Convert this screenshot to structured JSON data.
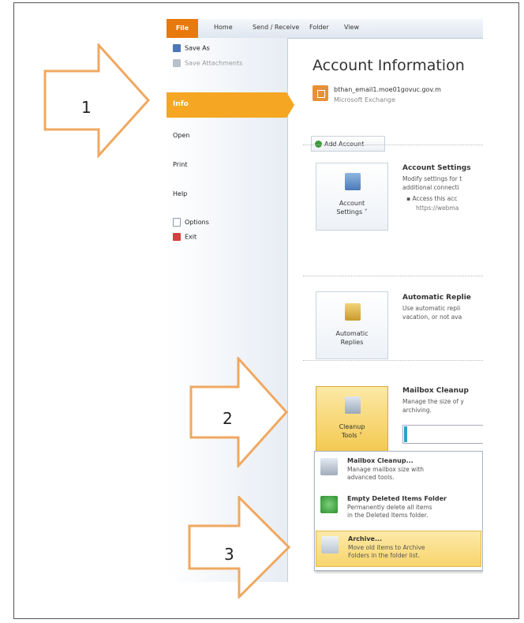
{
  "ribbon": {
    "file_tab": "File",
    "tabs": [
      "Home",
      "Send / Receive",
      "Folder",
      "View"
    ]
  },
  "backstage": {
    "save_as": "Save As",
    "save_attachments": "Save Attachments",
    "info": "Info",
    "open": "Open",
    "print": "Print",
    "help": "Help",
    "options": "Options",
    "exit": "Exit"
  },
  "account": {
    "title": "Account Information",
    "email": "bthan_email1.moe01govuc.gov.m",
    "type": "Microsoft Exchange",
    "add_account": "Add Account"
  },
  "account_settings": {
    "button_line1": "Account",
    "button_line2": "Settings ˅",
    "heading": "Account Settings",
    "line1": "Modify settings for t",
    "line2": "additional connecti",
    "bullet": "Access this acc",
    "url": "https://webma"
  },
  "auto_replies": {
    "button_line1": "Automatic",
    "button_line2": "Replies",
    "heading": "Automatic Replie",
    "line1": "Use automatic repli",
    "line2": "vacation, or not ava"
  },
  "mailbox_cleanup": {
    "button_line1": "Cleanup",
    "button_line2": "Tools ˅",
    "heading": "Mailbox Cleanup",
    "line1": "Manage the size of y",
    "line2": "archiving."
  },
  "cleanup_menu": [
    {
      "title": "Mailbox Cleanup...",
      "desc1": "Manage mailbox size with",
      "desc2": "advanced tools."
    },
    {
      "title": "Empty Deleted Items Folder",
      "desc1": "Permanently delete all items",
      "desc2": "in the Deleted Items folder."
    },
    {
      "title": "Archive...",
      "desc1": "Move old items to Archive",
      "desc2": "Folders in the folder list."
    }
  ],
  "callouts": {
    "step1": "1",
    "step2": "2",
    "step3": "3"
  },
  "colors": {
    "accent": "#e8790c",
    "arrow_stroke": "#f0a860",
    "selection": "#f7d56c"
  }
}
